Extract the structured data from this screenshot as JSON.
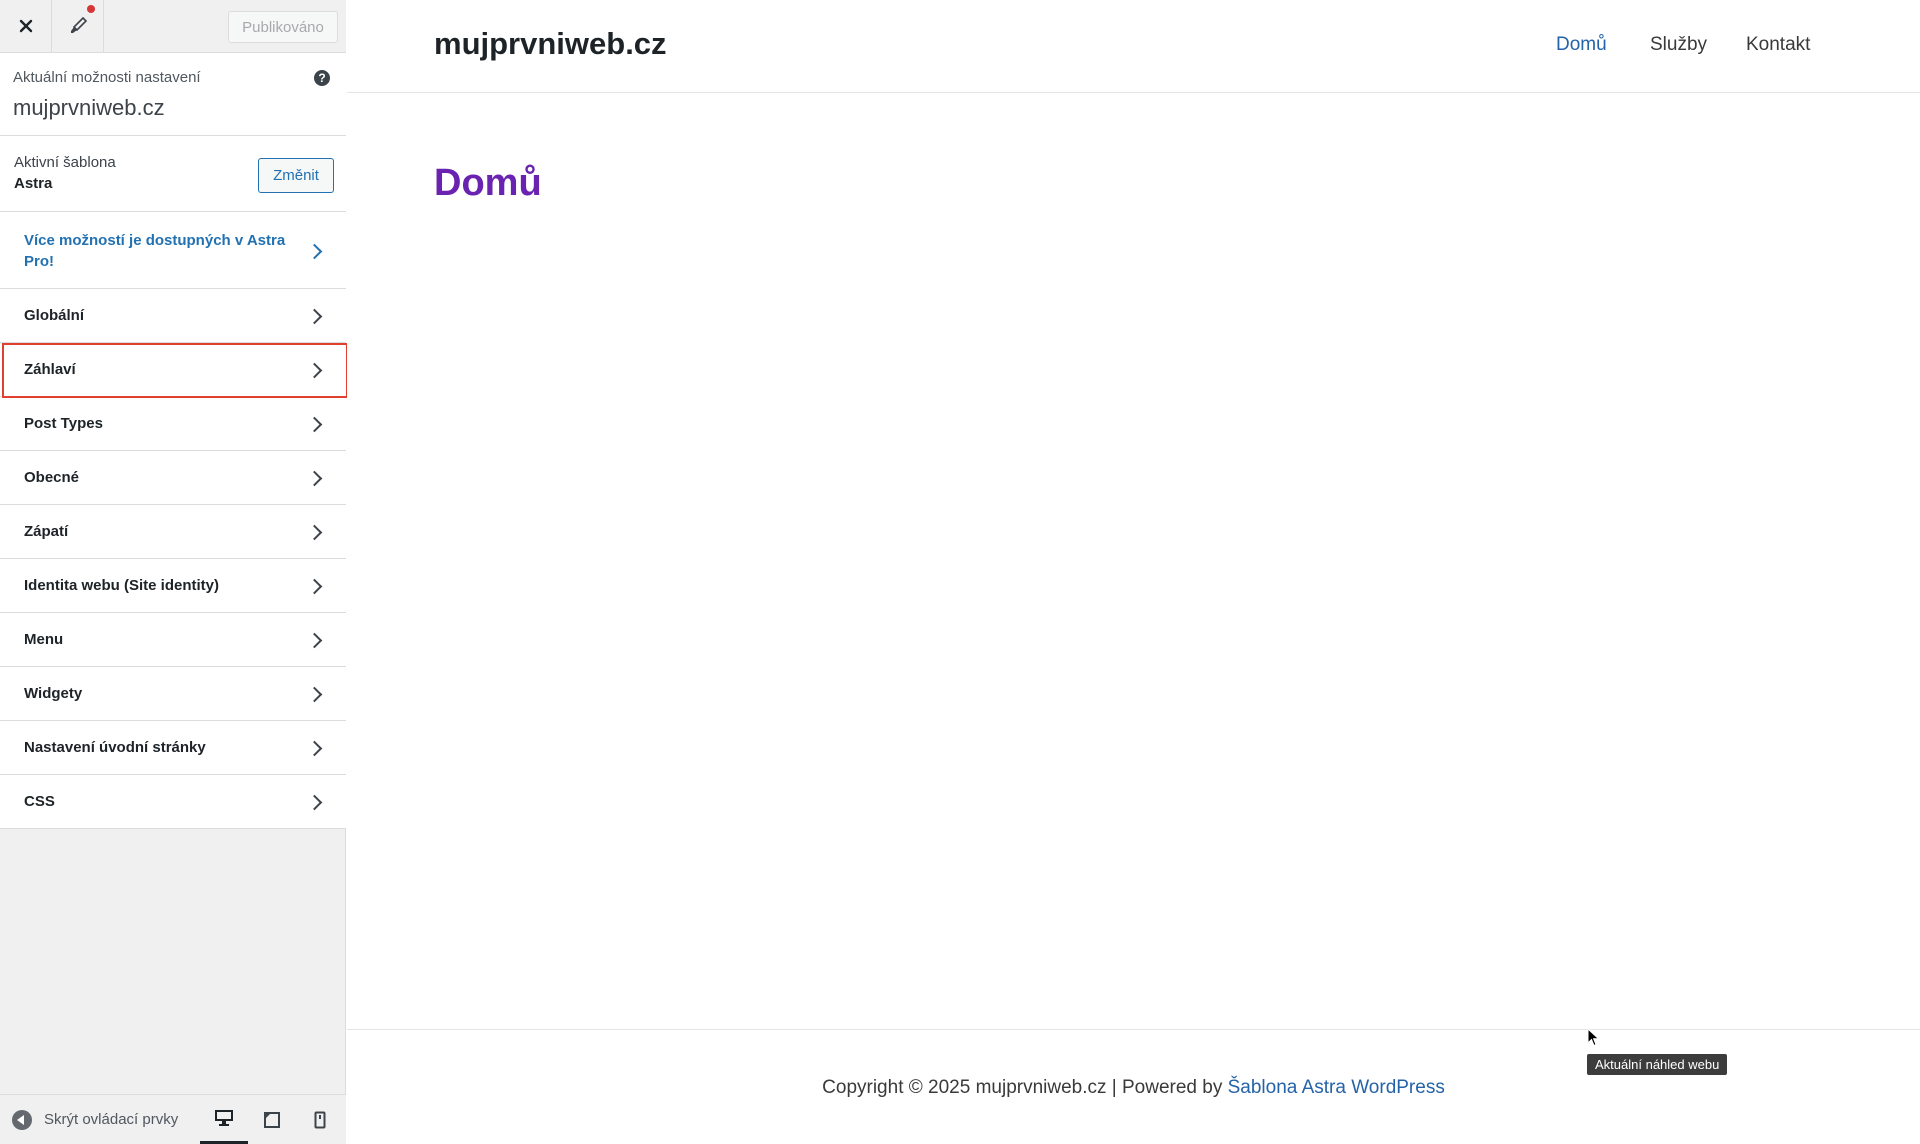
{
  "topbar": {
    "close_icon": "close-icon",
    "brush_icon": "brush-icon",
    "publish_label": "Publikováno"
  },
  "info": {
    "label": "Aktuální možnosti nastavení",
    "site_name": "mujprvniweb.cz"
  },
  "theme": {
    "label": "Aktivní šablona",
    "name": "Astra",
    "change_label": "Změnit"
  },
  "pro_notice": "Více možností je dostupných v Astra Pro!",
  "sections": [
    {
      "label": "Globální"
    },
    {
      "label": "Záhlaví"
    },
    {
      "label": "Post Types"
    },
    {
      "label": "Obecné"
    },
    {
      "label": "Zápatí"
    },
    {
      "label": "Identita webu (Site identity)"
    },
    {
      "label": "Menu"
    },
    {
      "label": "Widgety"
    },
    {
      "label": "Nastavení úvodní stránky"
    },
    {
      "label": "CSS"
    }
  ],
  "footer_bar": {
    "collapse_label": "Skrýt ovládací prvky"
  },
  "preview": {
    "site_title": "mujprvniweb.cz",
    "nav": [
      "Domů",
      "Služby",
      "Kontakt"
    ],
    "active_nav": "Domů",
    "page_heading": "Domů",
    "copyright_text": "Copyright © 2025 mujprvniweb.cz | Powered by ",
    "credit_link": "Šablona Astra WordPress",
    "tooltip": "Aktuální náhled webu"
  },
  "colors": {
    "accent": "#2271b1",
    "heading": "#6a22b0",
    "highlight": "#e2402f"
  }
}
